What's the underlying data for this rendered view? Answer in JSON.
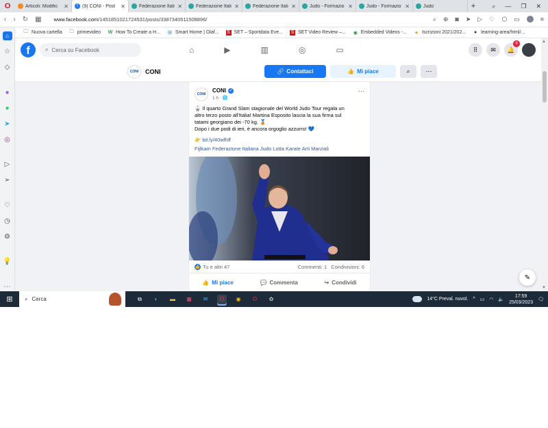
{
  "browser": {
    "tabs": [
      {
        "label": "Articoli: Modific",
        "icon": "joomla-icon",
        "active": false
      },
      {
        "label": "(9) CONI - Post",
        "icon": "facebook-icon",
        "active": true
      },
      {
        "label": "Federazione Itali",
        "icon": "site-icon",
        "active": false
      },
      {
        "label": "Federazione Itali",
        "icon": "site-icon",
        "active": false
      },
      {
        "label": "Federazione Itali",
        "icon": "site-icon",
        "active": false
      },
      {
        "label": "Judo - Formazio",
        "icon": "site-icon",
        "active": false
      },
      {
        "label": "Judo - Formazio",
        "icon": "site-icon",
        "active": false
      },
      {
        "label": "Judo",
        "icon": "site-icon",
        "active": false
      }
    ],
    "url_host": "www.facebook.com",
    "url_path": "/1451851021724531/posts/3387340511508896/",
    "bookmarks": [
      {
        "label": "Nuova cartella",
        "icon": "folder-icon"
      },
      {
        "label": "primevideo",
        "icon": "folder-icon"
      },
      {
        "label": "How To Create a H...",
        "icon": "w-icon"
      },
      {
        "label": "Smart Home | Olaf...",
        "icon": "wordpress-icon"
      },
      {
        "label": "SET – Sportdata Eve...",
        "icon": "set-icon"
      },
      {
        "label": "SET Video Review –...",
        "icon": "set-icon"
      },
      {
        "label": "Embedded Videos -...",
        "icon": "embed-icon"
      },
      {
        "label": "Iscrizioni 2021/202...",
        "icon": "star-icon"
      },
      {
        "label": "learning-area/html/...",
        "icon": "github-icon"
      }
    ]
  },
  "facebook": {
    "search_placeholder": "Cerca su Facebook",
    "notification_count": "9"
  },
  "page": {
    "name": "CONI",
    "avatar_text": "CONI",
    "contact_label": "Contattaci",
    "like_label": "Mi piace"
  },
  "post": {
    "author": "CONI",
    "time": "1 h · 🌐",
    "text_lines": [
      "🥋 Il quarto Grand Slam stagionale del World Judo Tour regala un",
      "altro terzo posto all'Italia! Martina Esposito lascia la sua firma sul",
      "tatami georgiano dei -70 kg. 🥉",
      "Dopo i due podi di ieri, è ancora orgoglio azzurro! 💙"
    ],
    "link": "👉 bit.ly/40wfhff",
    "tags": "Fijlkam Federazione Italiana Judo Lotta Karate Arti Marziali",
    "reactions": "Tu e altri 47",
    "comments": "Commenti: 1",
    "shares": "Condivisioni: 6",
    "actions": {
      "like": "Mi piace",
      "comment": "Commenta",
      "share": "Condividi"
    }
  },
  "taskbar": {
    "search_label": "Cerca",
    "weather": "14°C  Preval. nuvol.",
    "time": "17:59",
    "date": "25/03/2023"
  },
  "colors": {
    "facebook_blue": "#1877f2",
    "taskbar": "#1c2a3a",
    "judogi_blue": "#1f2e8f"
  }
}
